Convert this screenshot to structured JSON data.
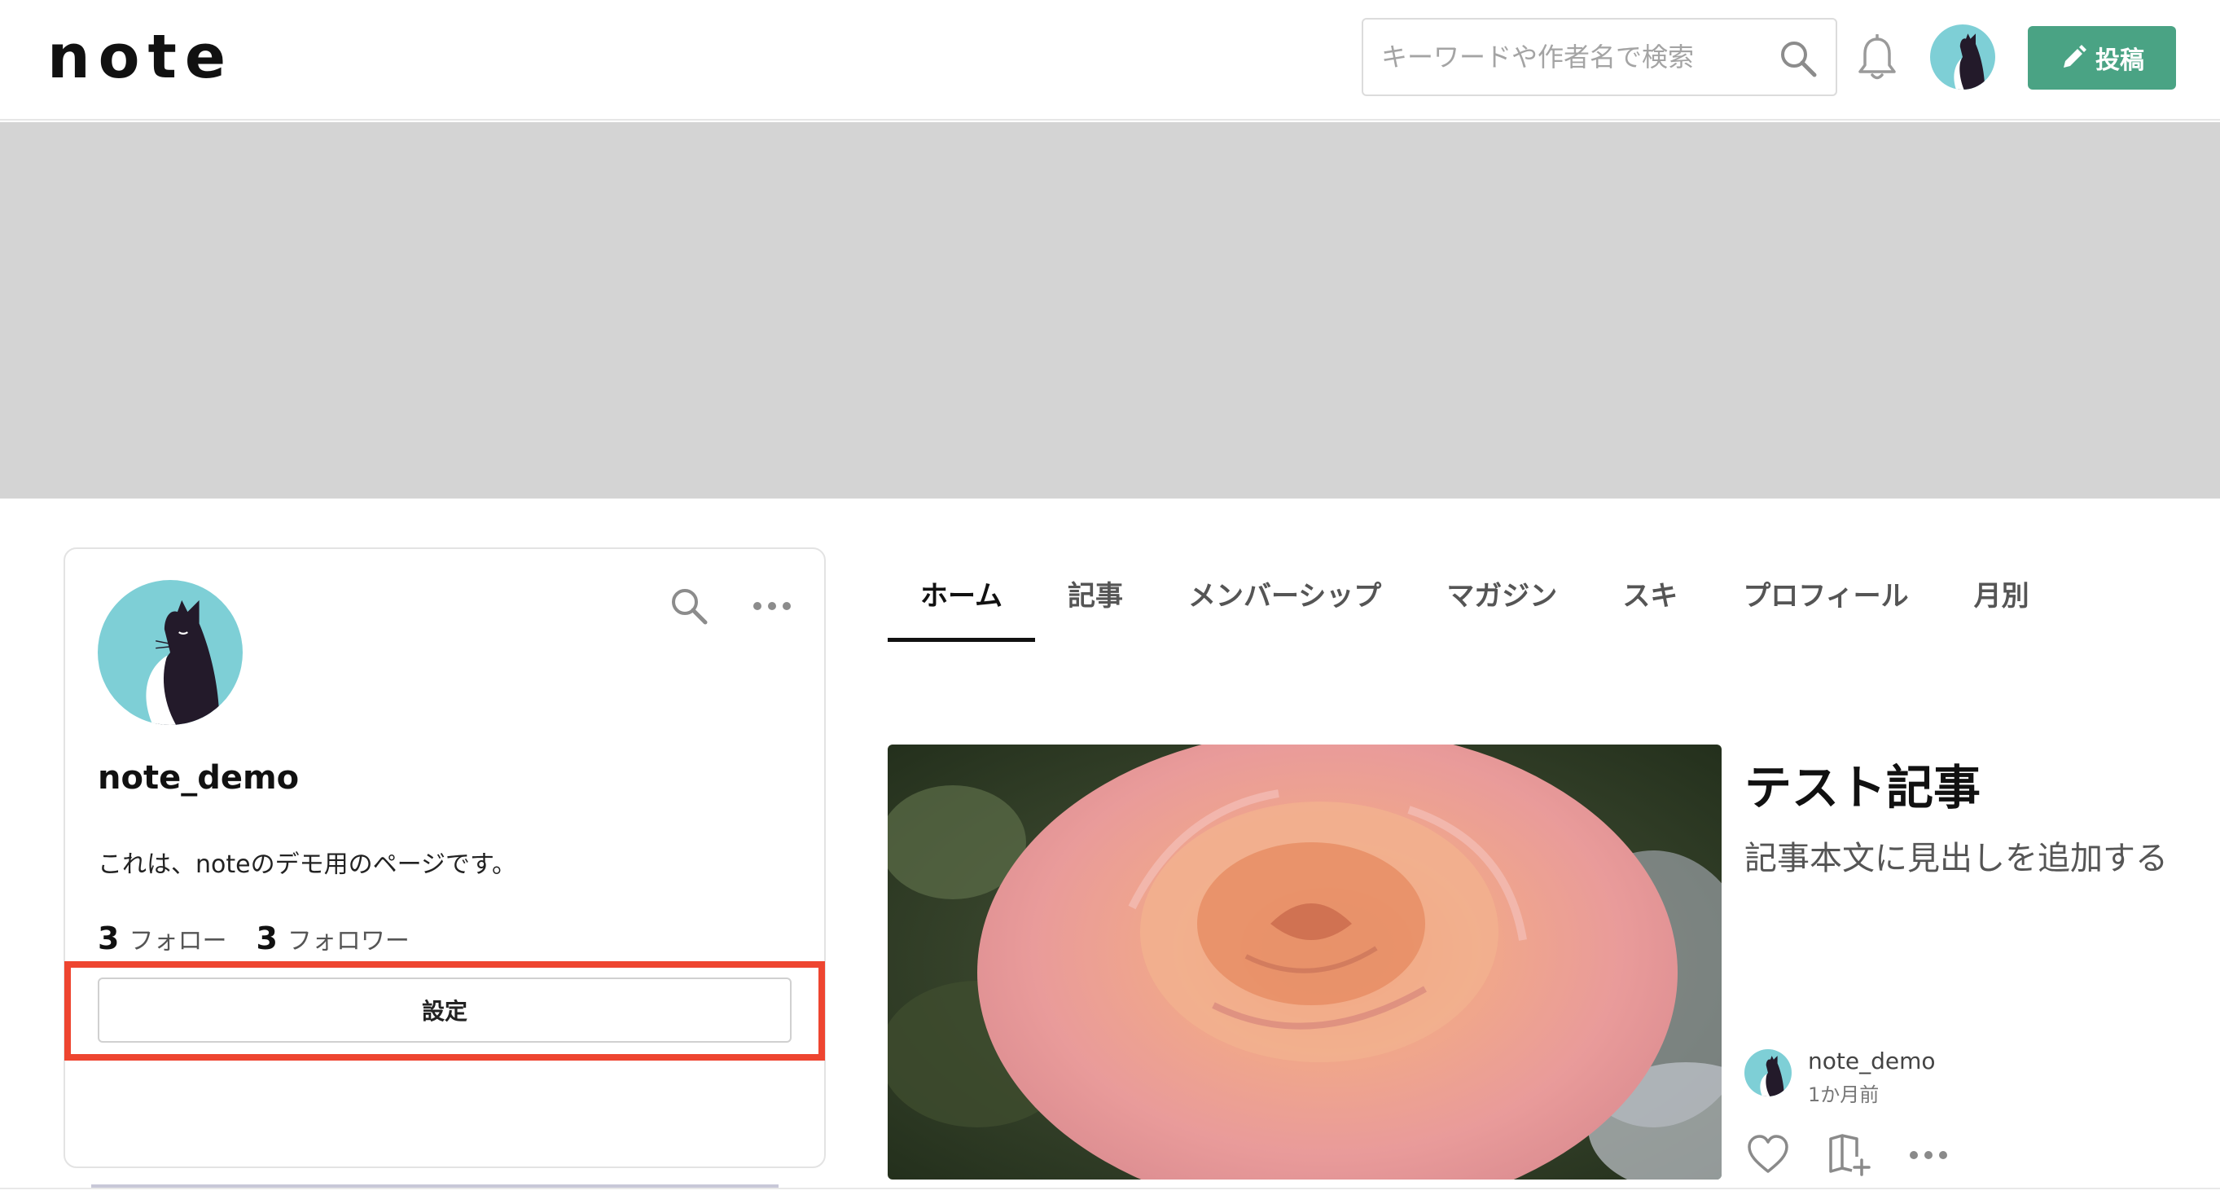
{
  "header": {
    "logo": "note",
    "search_placeholder": "キーワードや作者名で検索",
    "post_label": "投稿"
  },
  "profile": {
    "username": "note_demo",
    "bio": "これは、noteのデモ用のページです。",
    "follow_count": "3",
    "follow_label": "フォロー",
    "follower_count": "3",
    "follower_label": "フォロワー",
    "settings_label": "設定"
  },
  "tabs": [
    {
      "label": "ホーム",
      "active": true
    },
    {
      "label": "記事"
    },
    {
      "label": "メンバーシップ"
    },
    {
      "label": "マガジン"
    },
    {
      "label": "スキ"
    },
    {
      "label": "プロフィール"
    },
    {
      "label": "月別"
    }
  ],
  "article": {
    "title": "テスト記事",
    "excerpt": "記事本文に見出しを追加する",
    "author": "note_demo",
    "time": "1か月前"
  },
  "colors": {
    "accent": "#4aa384",
    "highlight": "#ee4530",
    "banner": "#d4d4d4",
    "avatar_bg": "#7ecfd6"
  }
}
